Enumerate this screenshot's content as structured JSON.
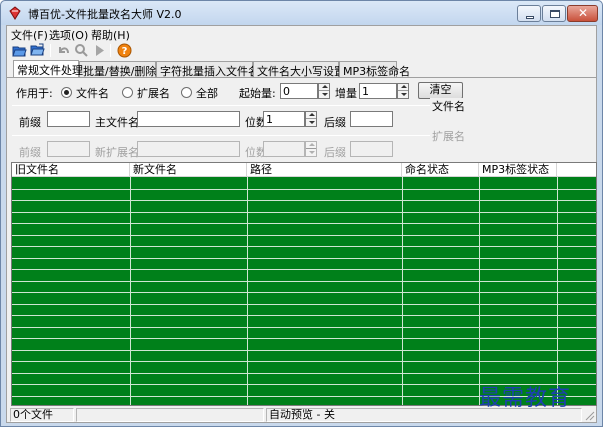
{
  "window": {
    "title": "博百优-文件批量改名大师 V2.0",
    "controls": {
      "minimize": "minimize",
      "maximize": "maximize",
      "close": "✕"
    }
  },
  "menu": {
    "items": [
      {
        "label": "文件(F)"
      },
      {
        "label": "选项(O)"
      },
      {
        "label": "帮助(H)"
      }
    ]
  },
  "toolbar": {
    "icons": [
      "open-file-icon",
      "open-folder-icon",
      "undo-icon",
      "search-icon",
      "play-icon",
      "help-icon"
    ]
  },
  "tabs": [
    {
      "label": "常规文件处理",
      "active": true
    },
    {
      "label": "批量/替换/删除"
    },
    {
      "label": "字符批量插入文件名"
    },
    {
      "label": "文件名大小写设置"
    },
    {
      "label": "MP3标签命名"
    }
  ],
  "options": {
    "apply_to_label": "作用于:",
    "radios": [
      {
        "label": "文件名",
        "checked": true
      },
      {
        "label": "扩展名",
        "checked": false
      },
      {
        "label": "全部",
        "checked": false
      }
    ],
    "start_label": "起始量:",
    "start_value": "0",
    "step_label": "增量",
    "step_value": "1",
    "clear_button": "清空"
  },
  "filename_group": {
    "title": "文件名",
    "prefix_label": "前缀",
    "prefix_value": "",
    "main_label": "主文件名",
    "main_value": "",
    "digits_label": "位数",
    "digits_value": "1",
    "suffix_label": "后缀",
    "suffix_value": ""
  },
  "extension_group": {
    "title": "扩展名",
    "prefix_label": "前缀",
    "prefix_value": "",
    "new_ext_label": "新扩展名",
    "new_ext_value": "",
    "digits_label": "位数",
    "digits_value": "",
    "suffix_label": "后缀",
    "suffix_value": ""
  },
  "list": {
    "columns": [
      "旧文件名",
      "新文件名",
      "路径",
      "命名状态",
      "MP3标签状态"
    ],
    "rows": [],
    "background": "#00801a"
  },
  "status": {
    "file_count": "0个文件",
    "middle": "",
    "auto_preview": "自动预览 - 关"
  },
  "watermark": "最需教育"
}
